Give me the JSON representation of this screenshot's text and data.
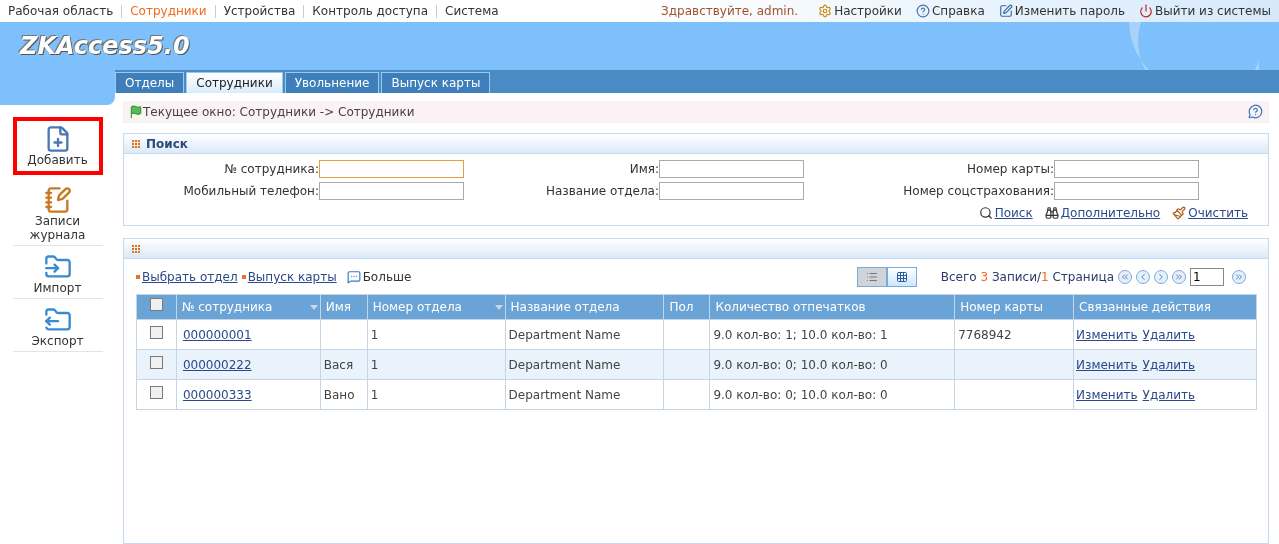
{
  "top_nav": [
    {
      "label": "Рабочая область",
      "selected": false
    },
    {
      "label": "Сотрудники",
      "selected": true
    },
    {
      "label": "Устройства",
      "selected": false
    },
    {
      "label": "Контроль доступа",
      "selected": false
    },
    {
      "label": "Система",
      "selected": false
    }
  ],
  "greeting": "Здравствуйте, admin.",
  "user_links": [
    {
      "kind": "settings",
      "label": "Настройки"
    },
    {
      "kind": "help",
      "label": "Справка"
    },
    {
      "kind": "password",
      "label": "Изменить пароль"
    },
    {
      "kind": "logout",
      "label": "Выйти из системы"
    }
  ],
  "logo": "ZKAccess5.0",
  "tabs": [
    {
      "label": "Отделы",
      "selected": false
    },
    {
      "label": "Сотрудники",
      "selected": true
    },
    {
      "label": "Увольнение",
      "selected": false
    },
    {
      "label": "Выпуск карты",
      "selected": false
    }
  ],
  "sidebar": [
    {
      "kind": "add",
      "label": "Добавить",
      "highlighted": true
    },
    {
      "kind": "log",
      "label": "Записи журнала",
      "highlighted": false
    },
    {
      "kind": "import",
      "label": "Импорт",
      "highlighted": false
    },
    {
      "kind": "export",
      "label": "Экспорт",
      "highlighted": false
    }
  ],
  "breadcrumb": "Текущее окно: Сотрудники -> Сотрудники",
  "search": {
    "title": "Поиск",
    "fields": [
      {
        "label": "№ сотрудника:",
        "focused": true
      },
      {
        "label": "Имя:",
        "focused": false
      },
      {
        "label": "Номер карты:",
        "focused": false
      },
      {
        "label": "Мобильный телефон:",
        "focused": false
      },
      {
        "label": "Название отдела:",
        "focused": false
      },
      {
        "label": "Номер соцстрахования:",
        "focused": false
      }
    ],
    "actions": [
      {
        "kind": "search",
        "label": "Поиск"
      },
      {
        "kind": "advanced",
        "label": "Дополнительно"
      },
      {
        "kind": "clear",
        "label": "Очистить"
      }
    ]
  },
  "toolbar": [
    {
      "kind": "bullet",
      "label": "Выбрать отдел"
    },
    {
      "kind": "bullet",
      "label": "Выпуск карты"
    },
    {
      "kind": "more",
      "label": "Больше"
    }
  ],
  "views": [
    {
      "kind": "list",
      "selected": true
    },
    {
      "kind": "grid",
      "selected": false
    }
  ],
  "pager": {
    "prefix": "Всего",
    "total": "3",
    "middle": "Записи/",
    "pages": "1",
    "suffix": "Страница",
    "page": "1"
  },
  "table": {
    "select_all": {
      "checked": false
    },
    "columns": [
      {
        "label": "№ сотрудника",
        "sortable": true
      },
      {
        "label": "Имя",
        "sortable": false
      },
      {
        "label": "Номер отдела",
        "sortable": true
      },
      {
        "label": "Название отдела",
        "sortable": false
      },
      {
        "label": "Пол",
        "sortable": false
      },
      {
        "label": "Количество отпечатков",
        "sortable": false
      },
      {
        "label": "Номер карты",
        "sortable": false
      },
      {
        "label": "Связанные действия",
        "sortable": false
      }
    ],
    "rows": [
      {
        "checked": false,
        "id": "000000001",
        "name": "",
        "dept_no": "1",
        "dept_name": "Department Name",
        "gender": "",
        "prints": "9.0 кол-во: 1; 10.0 кол-во: 1",
        "card": "7768942",
        "actions": [
          "Изменить",
          "Удалить"
        ]
      },
      {
        "checked": false,
        "id": "000000222",
        "name": "Вася",
        "dept_no": "1",
        "dept_name": "Department Name",
        "gender": "",
        "prints": "9.0 кол-во: 0; 10.0 кол-во: 0",
        "card": "",
        "actions": [
          "Изменить",
          "Удалить"
        ]
      },
      {
        "checked": false,
        "id": "000000333",
        "name": "Вано",
        "dept_no": "1",
        "dept_name": "Department Name",
        "gender": "",
        "prints": "9.0 кол-во: 0; 10.0 кол-во: 0",
        "card": "",
        "actions": [
          "Изменить",
          "Удалить"
        ]
      }
    ]
  }
}
